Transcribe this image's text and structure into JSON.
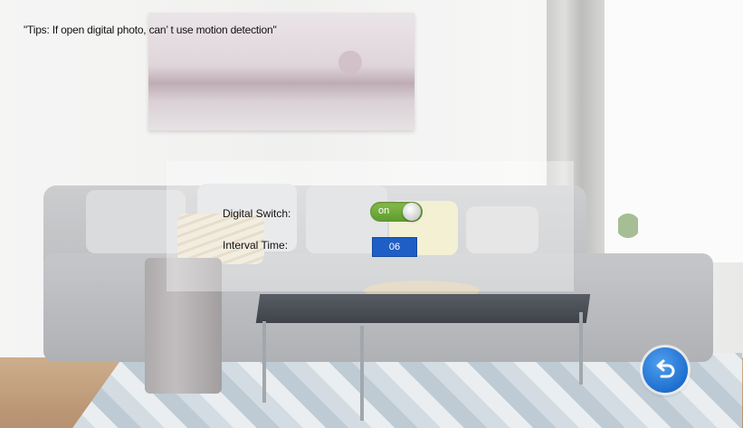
{
  "tips": "\"Tips: If open digital photo, can’ t use motion detection\"",
  "settings": {
    "digital_switch": {
      "label": "Digital Switch:",
      "value": "on"
    },
    "interval_time": {
      "label": "Interval Time:",
      "value": "06"
    }
  },
  "icons": {
    "back": "back-arrow-icon"
  },
  "colors": {
    "toggle_on": "#6faa36",
    "interval_box": "#1f5ec4",
    "back_button": "#1f6fd0"
  }
}
